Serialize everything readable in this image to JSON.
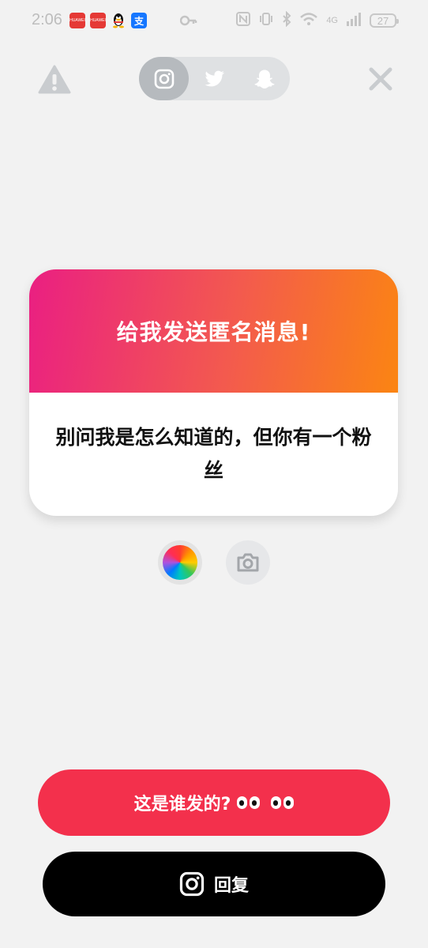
{
  "status_bar": {
    "time": "2:06",
    "app_icons": [
      "huawei-icon",
      "huawei-icon",
      "qq-icon",
      "alipay-icon"
    ],
    "alipay_glyph": "支",
    "network": "4G",
    "battery": "27"
  },
  "top_bar": {
    "tabs": [
      {
        "name": "instagram",
        "icon": "instagram-icon",
        "active": true
      },
      {
        "name": "twitter",
        "icon": "twitter-icon",
        "active": false
      },
      {
        "name": "snapchat",
        "icon": "snapchat-icon",
        "active": false
      }
    ]
  },
  "card": {
    "title": "给我发送匿名消息!",
    "message": "别问我是怎么知道的，但你有一个粉丝"
  },
  "bottom": {
    "who_label": "这是谁发的?",
    "reply_label": "回复"
  },
  "colors": {
    "gradient_start": "#ea1f82",
    "gradient_end": "#fb8512",
    "who_button": "#f3304c",
    "reply_button": "#000000",
    "background": "#f2f2f2"
  }
}
